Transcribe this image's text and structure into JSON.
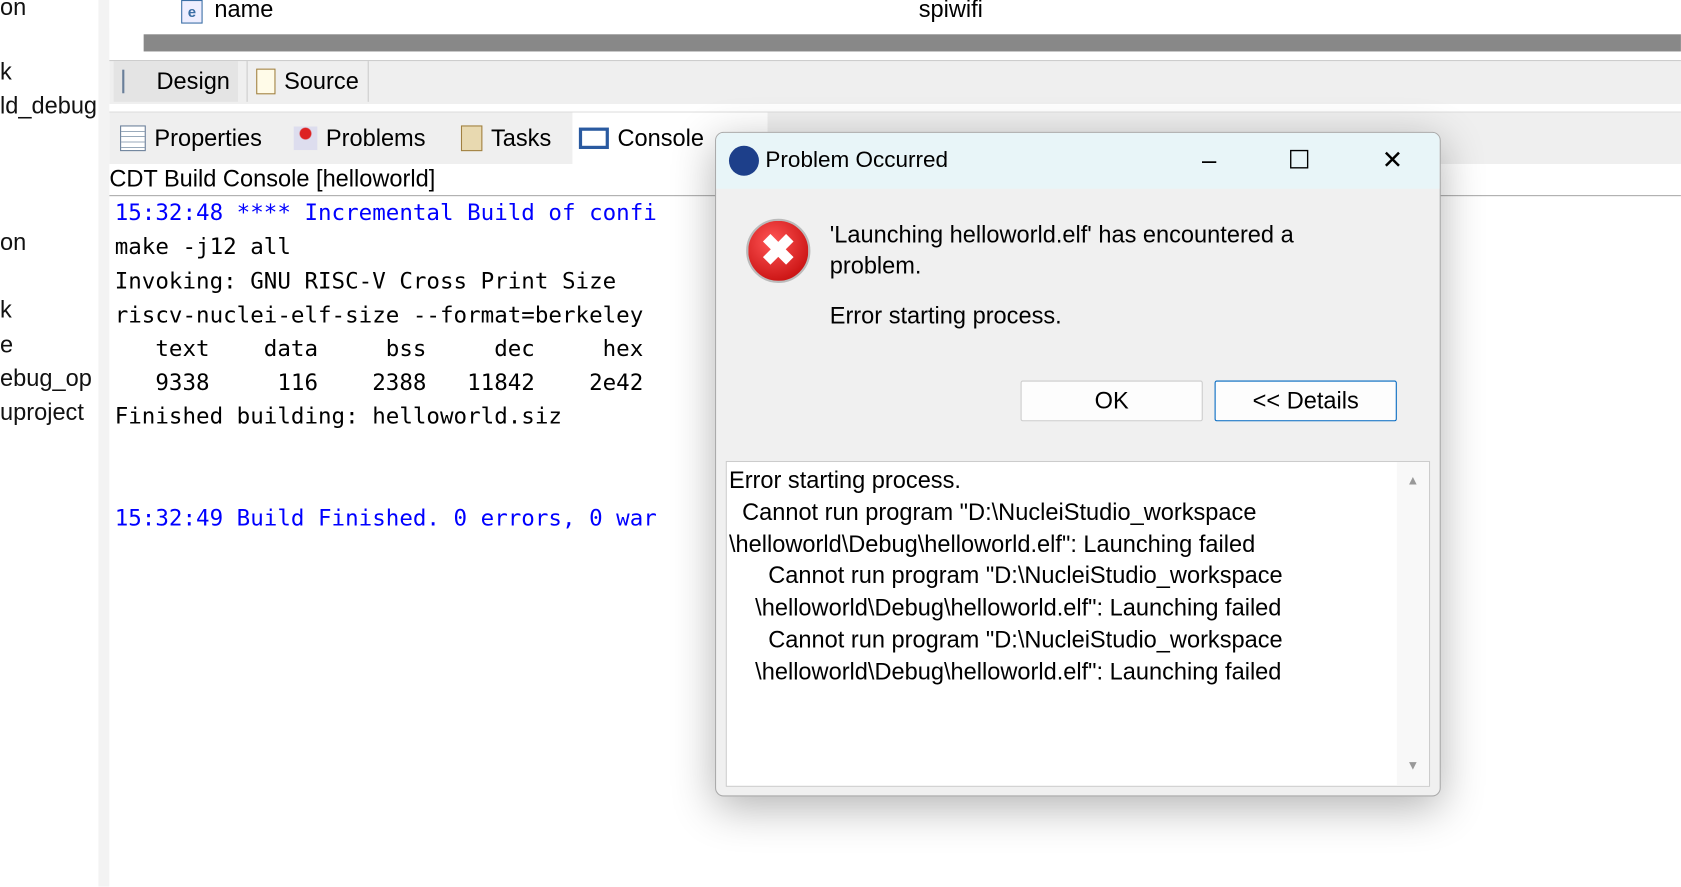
{
  "sidebar_fragments": [
    "on",
    "k",
    "ld_debug",
    "on",
    "k",
    "e",
    "ebug_op",
    "uproject"
  ],
  "editor": {
    "row_name": "name",
    "row_value": "spiwifi",
    "row_icon": "element-icon"
  },
  "editor_tabs": [
    {
      "label": "Design",
      "icon": "design-tree-icon"
    },
    {
      "label": "Source",
      "icon": "source-page-icon"
    }
  ],
  "panel_tabs": [
    {
      "label": "Properties",
      "icon": "properties-icon"
    },
    {
      "label": "Problems",
      "icon": "problems-icon"
    },
    {
      "label": "Tasks",
      "icon": "tasks-icon"
    },
    {
      "label": "Console",
      "icon": "console-icon",
      "active": true
    }
  ],
  "console": {
    "title": "CDT Build Console [helloworld]",
    "lines": [
      "15:32:48 **** Incremental Build of confi",
      "make -j12 all",
      "Invoking: GNU RISC-V Cross Print Size",
      "riscv-nuclei-elf-size --format=berkeley",
      "   text    data     bss     dec     hex",
      "   9338     116    2388   11842    2e42",
      "Finished building: helloworld.siz",
      "15:32:49 Build Finished. 0 errors, 0 war"
    ],
    "line_color": "#0000ff"
  },
  "dialog": {
    "title": "Problem Occurred",
    "message": "'Launching helloworld.elf' has encountered a problem.",
    "submessage": "Error starting process.",
    "ok_label": "OK",
    "details_label": "<< Details",
    "details_text": "Error starting process.\n  Cannot run program \"D:\\NucleiStudio_workspace\n\\helloworld\\Debug\\helloworld.elf\": Launching failed\n      Cannot run program \"D:\\NucleiStudio_workspace\n    \\helloworld\\Debug\\helloworld.elf\": Launching failed\n      Cannot run program \"D:\\NucleiStudio_workspace\n    \\helloworld\\Debug\\helloworld.elf\": Launching failed",
    "icon": "error-icon"
  }
}
